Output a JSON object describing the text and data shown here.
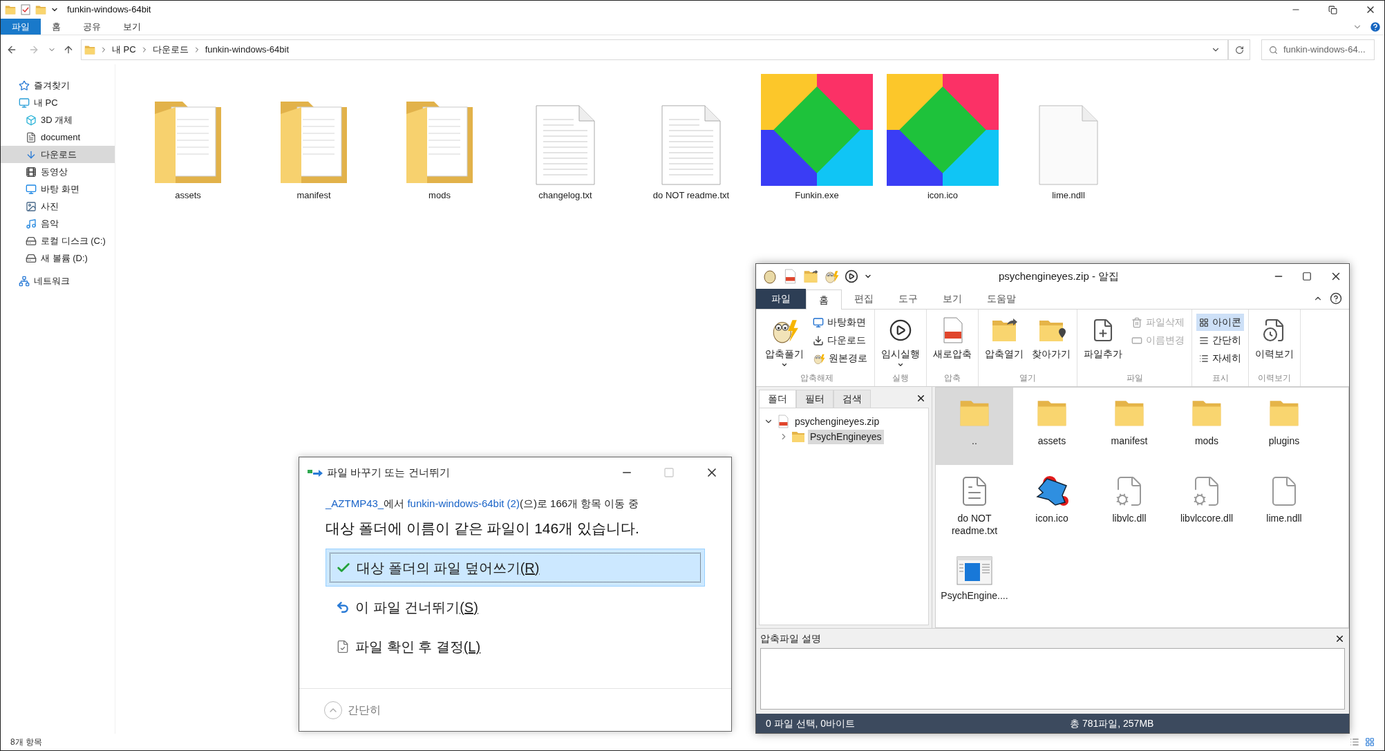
{
  "explorer": {
    "title": "funkin-windows-64bit",
    "ribbon_tabs": [
      {
        "label": "파일",
        "selected": true
      },
      {
        "label": "홈",
        "selected": false
      },
      {
        "label": "공유",
        "selected": false
      },
      {
        "label": "보기",
        "selected": false
      }
    ],
    "path": [
      "내 PC",
      "다운로드",
      "funkin-windows-64bit"
    ],
    "search": {
      "placeholder": "funkin-windows-64..."
    },
    "sidebar": [
      {
        "label": "즐겨찾기",
        "kind": "star",
        "selected": false
      },
      {
        "label": "내 PC",
        "kind": "pc",
        "selected": false,
        "children": [
          {
            "label": "3D 개체",
            "kind": "cube",
            "selected": false
          },
          {
            "label": "document",
            "kind": "doc",
            "selected": false
          },
          {
            "label": "다운로드",
            "kind": "download",
            "selected": true
          },
          {
            "label": "동영상",
            "kind": "video",
            "selected": false
          },
          {
            "label": "바탕 화면",
            "kind": "desktop",
            "selected": false
          },
          {
            "label": "사진",
            "kind": "picture",
            "selected": false
          },
          {
            "label": "음악",
            "kind": "music",
            "selected": false
          },
          {
            "label": "로컬 디스크 (C:)",
            "kind": "drive",
            "selected": false
          },
          {
            "label": "새 볼륨 (D:)",
            "kind": "drive",
            "selected": false
          }
        ]
      },
      {
        "label": "네트워크",
        "kind": "network",
        "selected": false
      }
    ],
    "files": [
      {
        "name": "assets",
        "kind": "folder"
      },
      {
        "name": "manifest",
        "kind": "folder"
      },
      {
        "name": "mods",
        "kind": "folder"
      },
      {
        "name": "changelog.txt",
        "kind": "text"
      },
      {
        "name": "do NOT readme.txt",
        "kind": "text"
      },
      {
        "name": "Funkin.exe",
        "kind": "logo"
      },
      {
        "name": "icon.ico",
        "kind": "logo"
      },
      {
        "name": "lime.ndll",
        "kind": "blank"
      }
    ],
    "status_bar": "8개 항목"
  },
  "alzip": {
    "title": "psychengineyes.zip - 알집",
    "tabs": [
      {
        "label": "파일",
        "kind": "menu",
        "selected": false
      },
      {
        "label": "홈",
        "kind": "tab",
        "selected": true
      },
      {
        "label": "편집",
        "kind": "tab",
        "selected": false
      },
      {
        "label": "도구",
        "kind": "tab",
        "selected": false
      },
      {
        "label": "보기",
        "kind": "tab",
        "selected": false
      },
      {
        "label": "도움말",
        "kind": "tab",
        "selected": false
      }
    ],
    "ribbon": [
      {
        "label": "압축해제",
        "items": [
          {
            "label": "압축풀기",
            "kind": "extract",
            "dropdown": true,
            "disabled": false,
            "selected": false
          },
          {
            "label": "바탕화면",
            "kind": "desktop",
            "dropdown": false,
            "disabled": false,
            "selected": false
          },
          {
            "label": "다운로드",
            "kind": "download",
            "dropdown": false,
            "disabled": false,
            "selected": false
          },
          {
            "label": "원본경로",
            "kind": "source",
            "dropdown": false,
            "disabled": false,
            "selected": false
          }
        ]
      },
      {
        "label": "실행",
        "items": [
          {
            "label": "임시실행",
            "kind": "run",
            "dropdown": true,
            "disabled": false,
            "selected": false
          }
        ]
      },
      {
        "label": "압축",
        "items": [
          {
            "label": "새로압축",
            "kind": "zip",
            "dropdown": false,
            "disabled": false,
            "selected": false
          }
        ]
      },
      {
        "label": "열기",
        "items": [
          {
            "label": "압축열기",
            "kind": "open",
            "dropdown": false,
            "disabled": false,
            "selected": false
          },
          {
            "label": "찾아가기",
            "kind": "find",
            "dropdown": false,
            "disabled": false,
            "selected": false
          }
        ]
      },
      {
        "label": "파일",
        "items": [
          {
            "label": "파일추가",
            "kind": "add",
            "dropdown": false,
            "disabled": false,
            "selected": false
          },
          {
            "label": "파일삭제",
            "kind": "delete",
            "dropdown": false,
            "disabled": true,
            "selected": false
          },
          {
            "label": "이름변경",
            "kind": "rename",
            "dropdown": false,
            "disabled": true,
            "selected": false
          }
        ]
      },
      {
        "label": "표시",
        "items": [
          {
            "label": "아이콘",
            "kind": "icons",
            "dropdown": false,
            "disabled": false,
            "selected": true
          },
          {
            "label": "간단히",
            "kind": "list",
            "dropdown": false,
            "disabled": false,
            "selected": false
          },
          {
            "label": "자세히",
            "kind": "details",
            "dropdown": false,
            "disabled": false,
            "selected": false
          }
        ]
      },
      {
        "label": "이력보기",
        "items": [
          {
            "label": "이력보기",
            "kind": "history",
            "dropdown": false,
            "disabled": false,
            "selected": false
          }
        ]
      }
    ],
    "panel_tabs": [
      {
        "label": "폴더",
        "selected": true
      },
      {
        "label": "필터",
        "selected": false
      },
      {
        "label": "검색",
        "selected": false
      }
    ],
    "tree": [
      {
        "label": "psychengineyes.zip",
        "kind": "archive",
        "expanded": true,
        "selected": false,
        "children": [
          {
            "label": "PsychEngineyes",
            "kind": "folder",
            "expanded": false,
            "selected": true
          }
        ]
      }
    ],
    "files": [
      {
        "name": "..",
        "kind": "folder",
        "selected": true
      },
      {
        "name": "assets",
        "kind": "folder",
        "selected": false
      },
      {
        "name": "manifest",
        "kind": "folder",
        "selected": false
      },
      {
        "name": "mods",
        "kind": "folder",
        "selected": false
      },
      {
        "name": "plugins",
        "kind": "folder",
        "selected": false
      },
      {
        "name": "do NOT readme.txt",
        "kind": "text",
        "selected": false
      },
      {
        "name": "icon.ico",
        "kind": "character",
        "selected": false
      },
      {
        "name": "libvlc.dll",
        "kind": "dll",
        "selected": false
      },
      {
        "name": "libvlccore.dll",
        "kind": "dll",
        "selected": false
      },
      {
        "name": "lime.ndll",
        "kind": "blank",
        "selected": false
      },
      {
        "name": "PsychEngine....",
        "kind": "app",
        "selected": false
      }
    ],
    "description": {
      "title": "압축파일 설명"
    },
    "status": {
      "selection": "0 파일 선택, 0바이트",
      "total": "총 781파일, 257MB"
    }
  },
  "dialog": {
    "title": "파일 바꾸기 또는 건너뛰기",
    "move_line": [
      {
        "kind": "link",
        "text": "_AZTMP43_"
      },
      {
        "kind": "text",
        "text": "에서 "
      },
      {
        "kind": "link",
        "text": "funkin-windows-64bit (2)"
      },
      {
        "kind": "text",
        "text": "(으)로 166개 항목 이동 중"
      }
    ],
    "heading": "대상 폴더에 이름이 같은 파일이 146개 있습니다.",
    "options": [
      {
        "label": "대상 폴더의 파일 덮어쓰기(R)",
        "kind": "replace",
        "selected": true
      },
      {
        "label": "이 파일 건너뛰기(S)",
        "kind": "skip",
        "selected": false
      },
      {
        "label": "파일 확인 후 결정(L)",
        "kind": "compare",
        "selected": false
      }
    ],
    "footer": "간단히"
  }
}
